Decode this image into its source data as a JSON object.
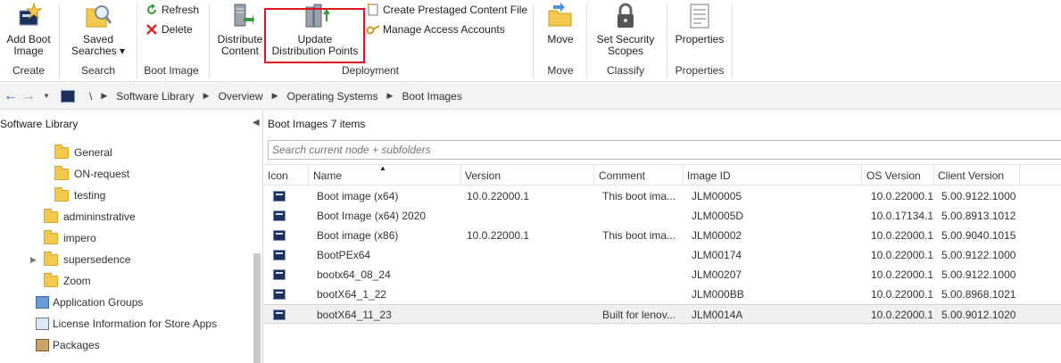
{
  "ribbon": {
    "create": {
      "button": "Add Boot\nImage",
      "label": "Create"
    },
    "search": {
      "button": "Saved\nSearches ▾",
      "label": "Search"
    },
    "bootimage": {
      "refresh": "Refresh",
      "delete": "Delete",
      "label": "Boot Image"
    },
    "deployment": {
      "distribute": "Distribute\nContent",
      "update": "Update\nDistribution Points",
      "prestaged": "Create Prestaged Content File",
      "access": "Manage Access Accounts",
      "label": "Deployment"
    },
    "move": {
      "button": "Move",
      "label": "Move"
    },
    "classify": {
      "button": "Set Security\nScopes",
      "label": "Classify"
    },
    "properties": {
      "button": "Properties",
      "label": "Properties"
    }
  },
  "address": {
    "root": "\\",
    "crumbs": [
      "Software Library",
      "Overview",
      "Operating Systems",
      "Boot Images"
    ]
  },
  "nav": {
    "title": "Software Library",
    "items": [
      "General",
      "ON-request",
      "testing",
      "admininstrative",
      "impero",
      "supersedence",
      "Zoom",
      "Application Groups",
      "License Information for Store Apps",
      "Packages"
    ]
  },
  "main": {
    "header": "Boot Images 7 items",
    "search_placeholder": "Search current node + subfolders",
    "columns": [
      "Icon",
      "Name",
      "Version",
      "Comment",
      "Image ID",
      "OS Version",
      "Client Version"
    ],
    "rows": [
      [
        "Boot image (x64)",
        "10.0.22000.1",
        "This boot ima...",
        "JLM00005",
        "10.0.22000.1",
        "5.00.9122.1000"
      ],
      [
        "Boot Image (x64) 2020",
        "",
        "",
        "JLM0005D",
        "10.0.17134.1",
        "5.00.8913.1012"
      ],
      [
        "Boot image (x86)",
        "10.0.22000.1",
        "This boot ima...",
        "JLM00002",
        "10.0.22000.1",
        "5.00.9040.1015"
      ],
      [
        "BootPEx64",
        "",
        "",
        "JLM00174",
        "10.0.22000.1",
        "5.00.9122.1000"
      ],
      [
        "bootx64_08_24",
        "",
        "",
        "JLM00207",
        "10.0.22000.1",
        "5.00.9122.1000"
      ],
      [
        "bootX64_1_22",
        "",
        "",
        "JLM000BB",
        "10.0.22000.1",
        "5.00.8968.1021"
      ],
      [
        "bootX64_11_23",
        "",
        "Built for lenov...",
        "JLM0014A",
        "10.0.22000.1",
        "5.00.9012.1020"
      ]
    ]
  },
  "colors": {
    "highlight": "#e0151f",
    "folder": "#f2c94c",
    "selected_row": "#f0f0f0"
  }
}
